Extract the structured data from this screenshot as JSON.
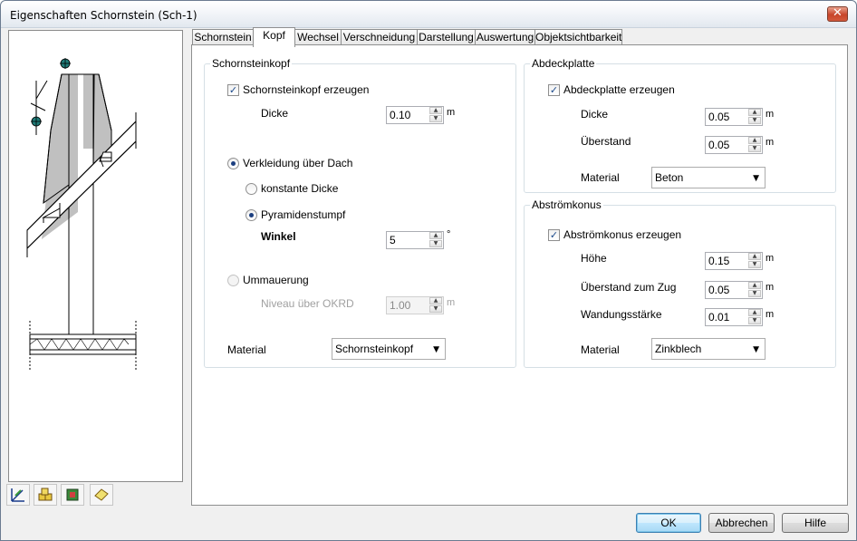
{
  "window": {
    "title": "Eigenschaften Schornstein (Sch-1)",
    "close_glyph": "✕"
  },
  "tabs": [
    "Schornstein",
    "Kopf",
    "Wechsel",
    "Verschneidung",
    "Darstellung",
    "Auswertung",
    "Objektsichtbarkeit"
  ],
  "active_tab": "Kopf",
  "left_group": {
    "title": "Schornsteinkopf",
    "create_label": "Schornsteinkopf erzeugen",
    "create_checked": true,
    "dicke_label": "Dicke",
    "dicke_value": "0.10",
    "dicke_unit": "m",
    "verkleidung_label": "Verkleidung über Dach",
    "konstant_label": "konstante Dicke",
    "pyramid_label": "Pyramidenstumpf",
    "winkel_label": "Winkel",
    "winkel_value": "5",
    "winkel_unit": "°",
    "ummauerung_label": "Ummauerung",
    "niveau_label": "Niveau über OKRD",
    "niveau_value": "1.00",
    "niveau_unit": "m",
    "material_label": "Material",
    "material_value": "Schornsteinkopf"
  },
  "abdeck_group": {
    "title": "Abdeckplatte",
    "create_label": "Abdeckplatte erzeugen",
    "create_checked": true,
    "dicke_label": "Dicke",
    "dicke_value": "0.05",
    "ueberstand_label": "Überstand",
    "ueberstand_value": "0.05",
    "unit": "m",
    "material_label": "Material",
    "material_value": "Beton"
  },
  "konus_group": {
    "title": "Abströmkonus",
    "create_label": "Abströmkonus erzeugen",
    "create_checked": true,
    "hoehe_label": "Höhe",
    "hoehe_value": "0.15",
    "zug_label": "Überstand zum Zug",
    "zug_value": "0.05",
    "wand_label": "Wandungsstärke",
    "wand_value": "0.01",
    "unit": "m",
    "material_label": "Material",
    "material_value": "Zinkblech"
  },
  "buttons": {
    "ok": "OK",
    "cancel": "Abbrechen",
    "help": "Hilfe"
  },
  "toolbar_icons": [
    "view-tool-icon",
    "cubes-icon",
    "layer-icon",
    "tag-icon"
  ]
}
